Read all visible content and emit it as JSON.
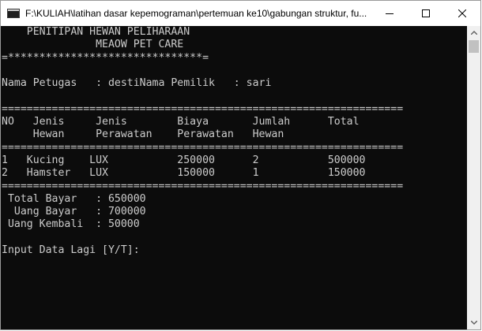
{
  "window": {
    "title": "F:\\KULIAH\\latihan dasar kepemograman\\pertemuan ke10\\gabungan struktur, fu...",
    "icon": "console-app-icon",
    "controls": [
      "minimize-icon",
      "maximize-icon",
      "close-icon"
    ]
  },
  "console": {
    "lines": [
      "    PENITIPAN HEWAN PELIHARAAN",
      "               MEAOW PET CARE",
      "=*******************************=",
      "",
      "Nama Petugas   : destiNama Pemilik   : sari",
      "",
      "================================================================",
      "NO   Jenis     Jenis        Biaya       Jumlah      Total",
      "     Hewan     Perawatan    Perawatan   Hewan",
      "================================================================",
      "1   Kucing    LUX           250000      2           500000",
      "2   Hamster   LUX           150000      1           150000",
      "================================================================",
      " Total Bayar   : 650000",
      "  Uang Bayar   : 700000",
      " Uang Kembali  : 50000",
      "",
      "Input Data Lagi [Y/T]:"
    ]
  },
  "scrollbar": {
    "up_icon": "chevron-up-icon",
    "down_icon": "chevron-down-icon"
  },
  "colors": {
    "console_bg": "#0c0c0c",
    "console_text": "#cccccc",
    "titlebar_bg": "#ffffff",
    "scrollbar_bg": "#f0f0f0",
    "scrollbar_thumb": "#c1c1c1"
  }
}
